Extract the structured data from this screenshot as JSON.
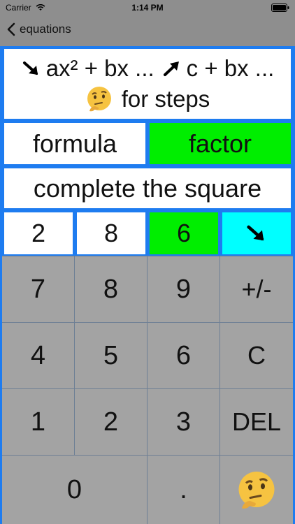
{
  "status": {
    "carrier": "Carrier",
    "time": "1:14 PM"
  },
  "nav": {
    "back_label": "equations"
  },
  "instructions": {
    "line1_part1": "ax² + bx ...",
    "line1_part2": "c + bx ...",
    "line2": "for steps"
  },
  "methods": {
    "formula": "formula",
    "factor": "factor",
    "complete": "complete the square"
  },
  "coefficients": {
    "a": "2",
    "b": "8",
    "c": "6"
  },
  "keypad": {
    "k7": "7",
    "k8": "8",
    "k9": "9",
    "sign": "+/-",
    "k4": "4",
    "k5": "5",
    "k6": "6",
    "clear": "C",
    "k1": "1",
    "k2": "2",
    "k3": "3",
    "del": "DEL",
    "k0": "0",
    "dot": "."
  },
  "colors": {
    "panel": "#1e7cf0",
    "selected": "#00ee00",
    "next": "#00ffff",
    "keypad": "#a3a3a3",
    "background": "#8e8e8e"
  },
  "icons": {
    "back": "chevron-left-icon",
    "thinking": "thinking-face-icon",
    "arrow_se": "arrow-down-right-icon",
    "arrow_ne": "arrow-up-right-icon"
  }
}
